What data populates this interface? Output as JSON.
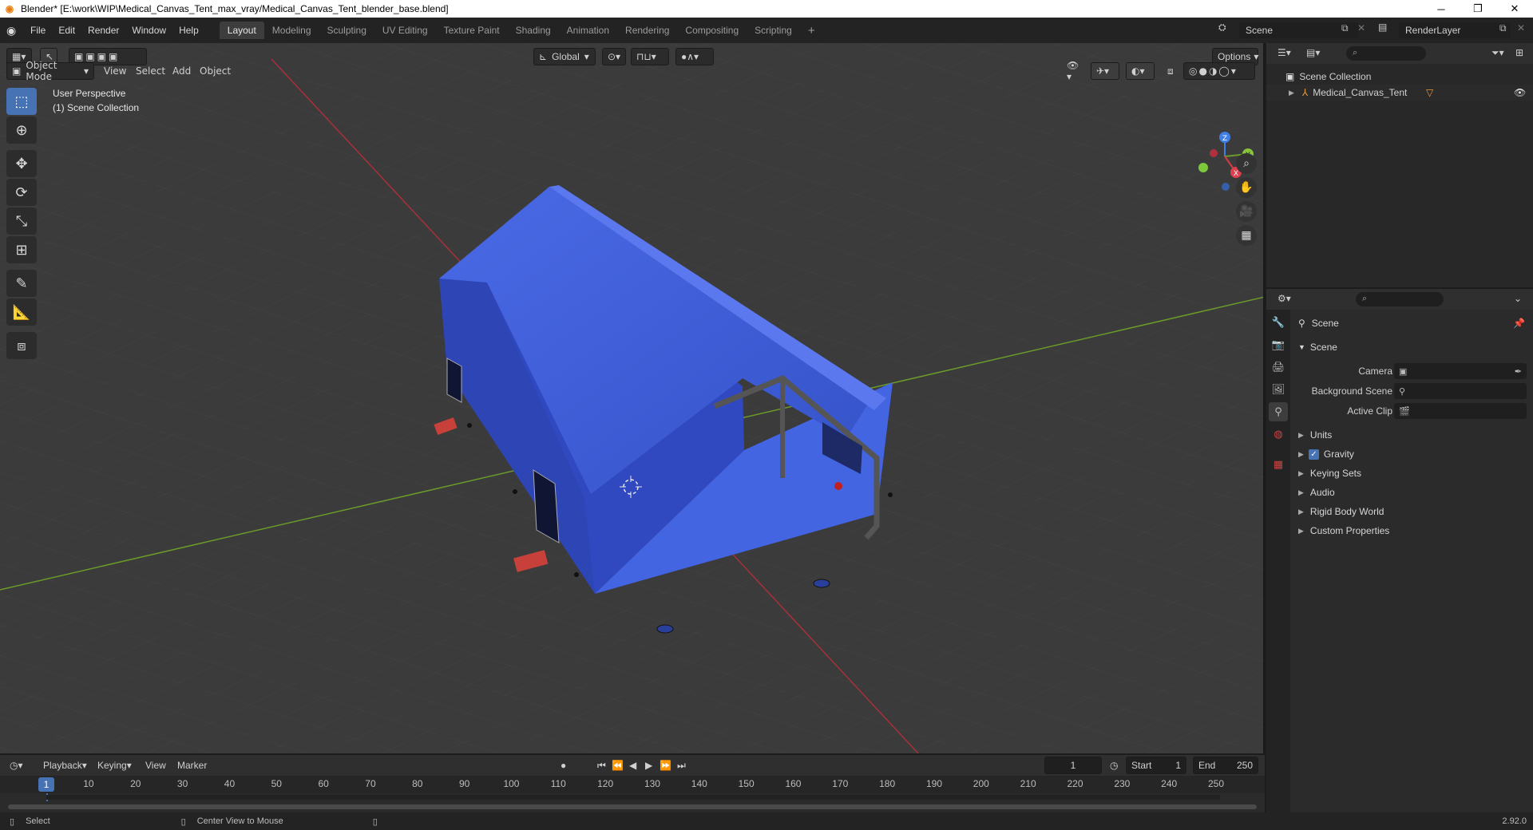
{
  "window": {
    "title": "Blender* [E:\\work\\WIP\\Medical_Canvas_Tent_max_vray/Medical_Canvas_Tent_blender_base.blend]",
    "minimize": "─",
    "restore": "❐",
    "close": "✕"
  },
  "menu": {
    "items": [
      "File",
      "Edit",
      "Render",
      "Window",
      "Help"
    ],
    "workspaces": [
      "Layout",
      "Modeling",
      "Sculpting",
      "UV Editing",
      "Texture Paint",
      "Shading",
      "Animation",
      "Rendering",
      "Compositing",
      "Scripting"
    ],
    "add_workspace": "+",
    "scene_name": "Scene",
    "view_layer": "RenderLayer"
  },
  "viewport": {
    "mode": "Object Mode",
    "menus": [
      "View",
      "Select",
      "Add",
      "Object"
    ],
    "transform_orientation": "Global",
    "options": "Options",
    "perspective_label": "User Perspective",
    "collection_label": "(1) Scene Collection",
    "gizmo": {
      "x": "X",
      "y": "Y",
      "z": "Z"
    }
  },
  "outliner": {
    "root": "Scene Collection",
    "items": [
      {
        "name": "Medical_Canvas_Tent"
      }
    ]
  },
  "properties": {
    "context": "Scene",
    "panel": "Scene",
    "fields": [
      {
        "label": "Camera",
        "value": ""
      },
      {
        "label": "Background Scene",
        "value": ""
      },
      {
        "label": "Active Clip",
        "value": ""
      }
    ],
    "sections": [
      {
        "label": "Units",
        "checkbox": false
      },
      {
        "label": "Gravity",
        "checkbox": true
      },
      {
        "label": "Keying Sets",
        "checkbox": false
      },
      {
        "label": "Audio",
        "checkbox": false
      },
      {
        "label": "Rigid Body World",
        "checkbox": false
      },
      {
        "label": "Custom Properties",
        "checkbox": false
      }
    ]
  },
  "timeline": {
    "menus": [
      "Playback",
      "Keying",
      "View",
      "Marker"
    ],
    "current_frame": "1",
    "start_label": "Start",
    "start": "1",
    "end_label": "End",
    "end": "250",
    "ticks": [
      "1",
      "10",
      "20",
      "30",
      "40",
      "50",
      "60",
      "70",
      "80",
      "90",
      "100",
      "110",
      "120",
      "130",
      "140",
      "150",
      "160",
      "170",
      "180",
      "190",
      "200",
      "210",
      "220",
      "230",
      "240",
      "250"
    ]
  },
  "statusbar": {
    "select": "Select",
    "center_view": "Center View to Mouse",
    "version": "2.92.0"
  },
  "colors": {
    "accent": "#4772b3",
    "tent": "#3b5bd6",
    "x_axis": "#a8303b",
    "y_axis": "#6a9b2a"
  }
}
